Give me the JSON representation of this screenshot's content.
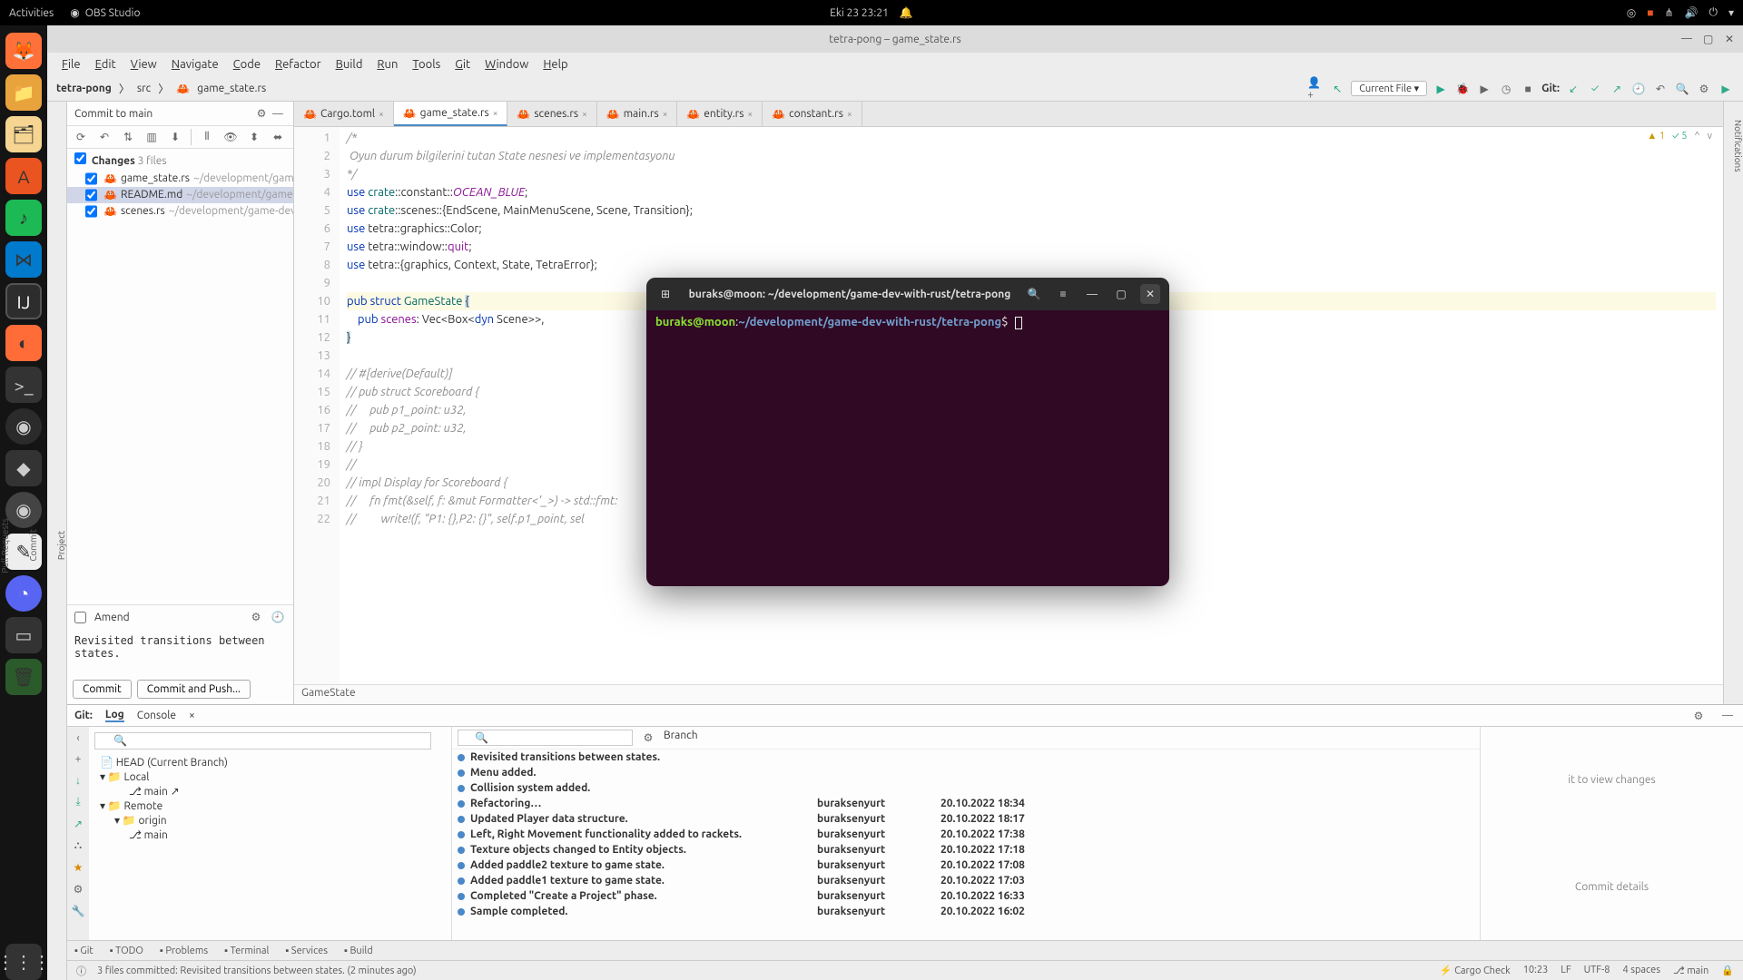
{
  "gnome": {
    "activities": "Activities",
    "app_indicator": "OBS Studio",
    "datetime": "Eki 23  23:21"
  },
  "ide": {
    "title": "tetra-pong – game_state.rs",
    "menus": [
      "File",
      "Edit",
      "View",
      "Navigate",
      "Code",
      "Refactor",
      "Build",
      "Run",
      "Tools",
      "Git",
      "Window",
      "Help"
    ],
    "project_name": "tetra-pong",
    "breadcrumb_src": "src",
    "breadcrumb_file": "game_state.rs",
    "run_config": "Current File",
    "git_label": "Git:"
  },
  "commit_panel": {
    "header": "Commit to main",
    "changes_label": "Changes",
    "changes_count": "3 files",
    "files": [
      {
        "name": "game_state.rs",
        "path": "~/development/game-dev-w"
      },
      {
        "name": "README.md",
        "path": "~/development/game-dev-wit"
      },
      {
        "name": "scenes.rs",
        "path": "~/development/game-dev-with-r"
      }
    ],
    "amend": "Amend",
    "message": "Revisited transitions between states.",
    "commit_btn": "Commit",
    "push_btn": "Commit and Push..."
  },
  "tabs": [
    {
      "name": "Cargo.toml"
    },
    {
      "name": "game_state.rs",
      "active": true
    },
    {
      "name": "scenes.rs"
    },
    {
      "name": "main.rs"
    },
    {
      "name": "entity.rs"
    },
    {
      "name": "constant.rs"
    }
  ],
  "editor": {
    "inspections_warn": "1",
    "inspections_weak": "5",
    "breadcrumb": "GameState",
    "lines": [
      {
        "n": 1,
        "raw": "/*",
        "cls": "comment"
      },
      {
        "n": 2,
        "raw": " Oyun durum bilgilerini tutan State nesnesi ve implementasyonu",
        "cls": "comment"
      },
      {
        "n": 3,
        "raw": "*/",
        "cls": "comment"
      },
      {
        "n": 4,
        "html": "<span class='kw'>use</span> <span class='type'>crate</span>::constant::<span class='const'>OCEAN_BLUE</span>;"
      },
      {
        "n": 5,
        "html": "<span class='kw'>use</span> <span class='type'>crate</span>::scenes::{EndScene, MainMenuScene, Scene, Transition};"
      },
      {
        "n": 6,
        "html": "<span class='kw'>use</span> tetra::graphics::Color;"
      },
      {
        "n": 7,
        "html": "<span class='kw'>use</span> tetra::window::<span class='field'>quit</span>;"
      },
      {
        "n": 8,
        "html": "<span class='kw'>use</span> tetra::{graphics, Context, State, TetraError};"
      },
      {
        "n": 9,
        "raw": ""
      },
      {
        "n": 10,
        "html": "<span class='kw'>pub struct</span> <span class='type'>GameState</span> <span class='cursor-brace'>{</span>",
        "hl": true
      },
      {
        "n": 11,
        "html": "    <span class='kw'>pub</span> <span class='field'>scenes</span>: Vec&lt;Box&lt;<span class='kw'>dyn</span> Scene&gt;&gt;,"
      },
      {
        "n": 12,
        "html": "<span class='cursor-brace'>}</span>"
      },
      {
        "n": 13,
        "raw": ""
      },
      {
        "n": 14,
        "raw": "// #[derive(Default)]",
        "cls": "comment"
      },
      {
        "n": 15,
        "raw": "// pub struct Scoreboard {",
        "cls": "comment"
      },
      {
        "n": 16,
        "raw": "//     pub p1_point: u32,",
        "cls": "comment"
      },
      {
        "n": 17,
        "raw": "//     pub p2_point: u32,",
        "cls": "comment"
      },
      {
        "n": 18,
        "raw": "// }",
        "cls": "comment"
      },
      {
        "n": 19,
        "raw": "//",
        "cls": "comment"
      },
      {
        "n": 20,
        "raw": "// impl Display for Scoreboard {",
        "cls": "comment"
      },
      {
        "n": 21,
        "raw": "//     fn fmt(&self, f: &mut Formatter<'_>) -> std::fmt:",
        "cls": "comment"
      },
      {
        "n": 22,
        "raw": "//         write!(f, \"P1: {},P2: {}\", self.p1_point, sel",
        "cls": "comment"
      }
    ]
  },
  "git_panel": {
    "label": "Git:",
    "tabs": [
      "Log",
      "Console"
    ],
    "branch_label": "Branch",
    "head": "HEAD (Current Branch)",
    "local": "Local",
    "local_main": "main",
    "remote": "Remote",
    "origin": "origin",
    "origin_main": "main",
    "commits": [
      {
        "msg": "Revisited transitions between states.",
        "bold": true
      },
      {
        "msg": "Menu added.",
        "bold": true
      },
      {
        "msg": "Collision system added.",
        "bold": true
      },
      {
        "msg": "Refactoring…",
        "bold": true,
        "author": "buraksenyurt",
        "date": "20.10.2022 18:34"
      },
      {
        "msg": "Updated Player data structure.",
        "bold": true,
        "author": "buraksenyurt",
        "date": "20.10.2022 18:17"
      },
      {
        "msg": "Left, Right Movement functionality added to rackets.",
        "bold": true,
        "author": "buraksenyurt",
        "date": "20.10.2022 17:38"
      },
      {
        "msg": "Texture objects changed to Entity objects.",
        "bold": true,
        "author": "buraksenyurt",
        "date": "20.10.2022 17:18"
      },
      {
        "msg": "Added paddle2 texture to game state.",
        "bold": true,
        "author": "buraksenyurt",
        "date": "20.10.2022 17:08"
      },
      {
        "msg": "Added paddle1 texture to game state.",
        "bold": true,
        "author": "buraksenyurt",
        "date": "20.10.2022 17:03"
      },
      {
        "msg": "Completed \"Create a Project\" phase.",
        "bold": true,
        "author": "buraksenyurt",
        "date": "20.10.2022 16:33"
      },
      {
        "msg": "Sample completed.",
        "bold": true,
        "author": "buraksenyurt",
        "date": "20.10.2022 16:02"
      }
    ],
    "view_changes_hint": "it to view changes",
    "details_hint": "Commit details"
  },
  "bottom_tabs": [
    "Git",
    "TODO",
    "Problems",
    "Terminal",
    "Services",
    "Build"
  ],
  "statusbar": {
    "msg": "3 files committed: Revisited transitions between states. (2 minutes ago)",
    "cargo": "Cargo Check",
    "pos": "10:23",
    "lf": "LF",
    "enc": "UTF-8",
    "indent": "4 spaces",
    "branch": "main"
  },
  "terminal": {
    "title": "buraks@moon: ~/development/game-dev-with-rust/tetra-pong",
    "user": "buraks@moon",
    "colon": ":",
    "path": "~/development/game-dev-with-rust/tetra-pong",
    "dollar": "$"
  }
}
